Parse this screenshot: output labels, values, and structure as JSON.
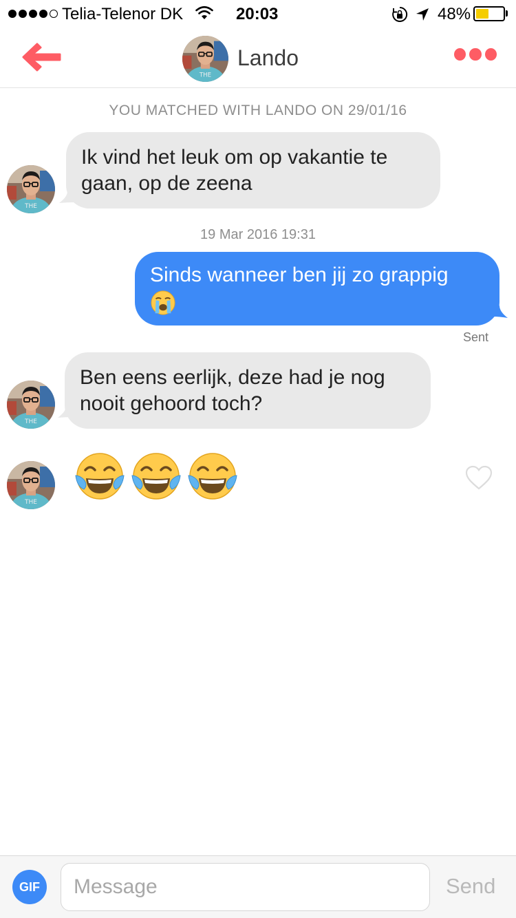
{
  "status_bar": {
    "carrier": "Telia-Telenor DK",
    "time": "20:03",
    "battery": "48%",
    "battery_level": 0.48,
    "signal_bars": 4,
    "signal_max": 5
  },
  "header": {
    "contact_name": "Lando",
    "avatar_shirt_text": "THE",
    "accent_color": "#fe5c64"
  },
  "chat": {
    "match_note": "YOU MATCHED WITH LANDO ON 29/01/16",
    "timestamp": "19 Mar 2016 19:31",
    "messages": [
      {
        "direction": "in",
        "lines": [
          "Ik vind het leuk om op vakantie te",
          "gaan, op de zeena"
        ]
      },
      {
        "direction": "out",
        "text": "Sinds wanneer ben jij zo grappig",
        "emoji": "loudly-crying-face",
        "status": "Sent"
      },
      {
        "direction": "in",
        "lines": [
          "Ben eens eerlijk, deze had je nog",
          "nooit gehoord toch?"
        ]
      },
      {
        "direction": "in",
        "emojis": [
          "tears-of-joy",
          "tears-of-joy",
          "tears-of-joy"
        ]
      }
    ]
  },
  "composer": {
    "gif_label": "GIF",
    "placeholder": "Message",
    "send_label": "Send"
  },
  "colors": {
    "outgoing_bubble": "#3d8af7",
    "incoming_bubble": "#e9e9e9",
    "battery": "#f5cd00"
  }
}
